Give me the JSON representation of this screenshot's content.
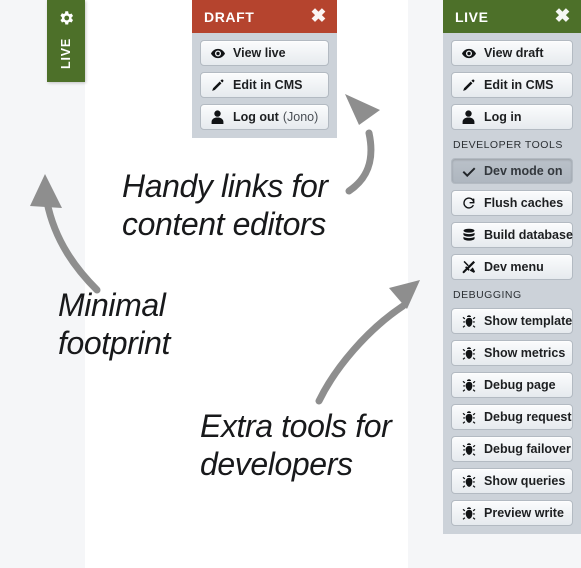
{
  "collapsed_tab": {
    "label": "LIVE",
    "icon": "gear-icon",
    "color": "#4d7029"
  },
  "draft_panel": {
    "title": "DRAFT",
    "header_color": "#b5442e",
    "close_label": "✖",
    "buttons": [
      {
        "icon": "eye-icon",
        "label": "View live",
        "sub": ""
      },
      {
        "icon": "pencil-icon",
        "label": "Edit in CMS",
        "sub": ""
      },
      {
        "icon": "user-icon",
        "label": "Log out",
        "sub": "(Jono)"
      }
    ]
  },
  "live_panel": {
    "title": "LIVE",
    "header_color": "#4d7029",
    "close_label": "✖",
    "buttons": [
      {
        "icon": "eye-icon",
        "label": "View draft",
        "sub": ""
      },
      {
        "icon": "pencil-icon",
        "label": "Edit in CMS",
        "sub": ""
      },
      {
        "icon": "user-icon",
        "label": "Log in",
        "sub": ""
      }
    ],
    "sections": [
      {
        "label": "DEVELOPER TOOLS",
        "buttons": [
          {
            "icon": "check-icon",
            "label": "Dev mode on",
            "active": true
          },
          {
            "icon": "refresh-icon",
            "label": "Flush caches",
            "active": false
          },
          {
            "icon": "database-icon",
            "label": "Build database",
            "active": false
          },
          {
            "icon": "tools-icon",
            "label": "Dev menu",
            "active": false
          }
        ]
      },
      {
        "label": "DEBUGGING",
        "buttons": [
          {
            "icon": "bug-icon",
            "label": "Show template",
            "active": false
          },
          {
            "icon": "bug-icon",
            "label": "Show metrics",
            "active": false
          },
          {
            "icon": "bug-icon",
            "label": "Debug page",
            "active": false
          },
          {
            "icon": "bug-icon",
            "label": "Debug request",
            "active": false
          },
          {
            "icon": "bug-icon",
            "label": "Debug failover",
            "active": false
          },
          {
            "icon": "bug-icon",
            "label": "Show queries",
            "active": false
          },
          {
            "icon": "bug-icon",
            "label": "Preview write",
            "active": false
          }
        ]
      }
    ]
  },
  "annotations": [
    {
      "id": "handy",
      "text": "Handy links for\ncontent editors"
    },
    {
      "id": "minimal",
      "text": "Minimal\nfootprint"
    },
    {
      "id": "extra",
      "text": "Extra tools for\ndevelopers"
    }
  ],
  "arrows": {
    "color": "#8e8e8e",
    "items": [
      {
        "name": "arrow-to-collapsed-tab"
      },
      {
        "name": "arrow-to-draft-panel"
      },
      {
        "name": "arrow-to-live-panel"
      }
    ]
  }
}
